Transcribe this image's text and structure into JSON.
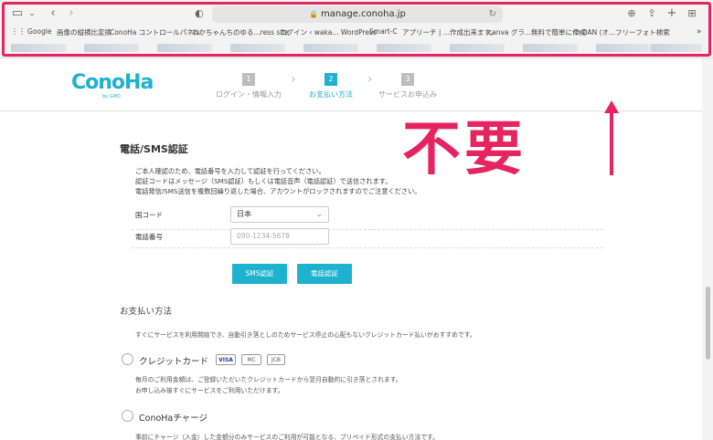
{
  "browser": {
    "url": "manage.conoha.jp",
    "bookmarks": [
      "Google",
      "画像の縦横比変換",
      "ConoHa コントロールパネル",
      "わかちゃんちのゆる...ress site",
      "ログイン ‹ waka... WordPress",
      "Smart-C",
      "アプリーチ | ...作成出来ます。",
      "canva グラ...無料で簡単に作成",
      "O-DAN (オ...フリーフォト検索"
    ]
  },
  "header": {
    "logo": "ConoHa",
    "logo_sub": "by GMO",
    "steps": [
      {
        "num": "1",
        "label": "ログイン・情報入力"
      },
      {
        "num": "2",
        "label": "お支払い方法"
      },
      {
        "num": "3",
        "label": "サービスお申込み"
      }
    ]
  },
  "sms": {
    "title": "電話/SMS認証",
    "desc": [
      "ご本人確認のため、電話番号を入力して認証を行ってください。",
      "認証コードはメッセージ（SMS認証）もしくは電話音声（電話認証）で送信されます。",
      "電話発信/SMS送信を複数回繰り返した場合、アカウントがロックされますのでご注意ください。"
    ],
    "country_label": "国コード",
    "country_value": "日本",
    "phone_label": "電話番号",
    "phone_placeholder": "090-1234-5678",
    "sms_button": "SMS認証",
    "call_button": "電話認証"
  },
  "payment": {
    "title": "お支払い方法",
    "intro": "すぐにサービスを利用開始でき、自動引き落としのためサービス停止の心配もないクレジットカード払いがおすすめです。",
    "credit": {
      "label": "クレジットカード",
      "brands": [
        "VISA",
        "MC",
        "JCB"
      ],
      "note1": "毎月のご利用金額は、ご登録いただいたクレジットカードから翌月自動的に引き落とされます。",
      "note2": "お申し込み後すぐにサービスをご利用いただけます。"
    },
    "charge": {
      "label": "ConoHaチャージ",
      "note": "事前にチャージ（入金）した金額分のみサービスのご利用が可能となる、プリペイド形式の支払い方法です。"
    }
  },
  "annotation": {
    "text": "不要",
    "color": "#e6245f"
  },
  "colors": {
    "accent": "#1fb2cf",
    "annotation": "#e6245f"
  }
}
